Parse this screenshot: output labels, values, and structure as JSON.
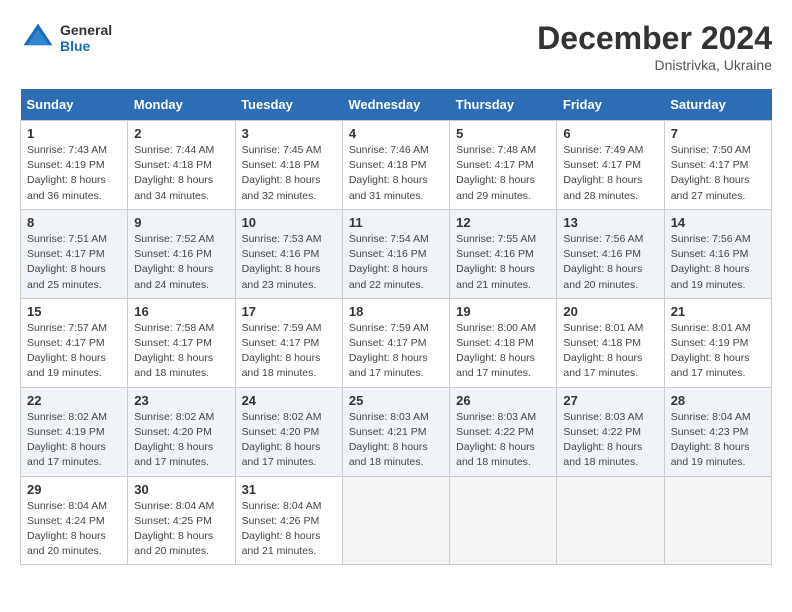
{
  "header": {
    "logo": {
      "general": "General",
      "blue": "Blue"
    },
    "title": "December 2024",
    "subtitle": "Dnistrivka, Ukraine"
  },
  "weekdays": [
    "Sunday",
    "Monday",
    "Tuesday",
    "Wednesday",
    "Thursday",
    "Friday",
    "Saturday"
  ],
  "weeks": [
    [
      {
        "day": "1",
        "sunrise": "7:43 AM",
        "sunset": "4:19 PM",
        "daylight": "8 hours and 36 minutes."
      },
      {
        "day": "2",
        "sunrise": "7:44 AM",
        "sunset": "4:18 PM",
        "daylight": "8 hours and 34 minutes."
      },
      {
        "day": "3",
        "sunrise": "7:45 AM",
        "sunset": "4:18 PM",
        "daylight": "8 hours and 32 minutes."
      },
      {
        "day": "4",
        "sunrise": "7:46 AM",
        "sunset": "4:18 PM",
        "daylight": "8 hours and 31 minutes."
      },
      {
        "day": "5",
        "sunrise": "7:48 AM",
        "sunset": "4:17 PM",
        "daylight": "8 hours and 29 minutes."
      },
      {
        "day": "6",
        "sunrise": "7:49 AM",
        "sunset": "4:17 PM",
        "daylight": "8 hours and 28 minutes."
      },
      {
        "day": "7",
        "sunrise": "7:50 AM",
        "sunset": "4:17 PM",
        "daylight": "8 hours and 27 minutes."
      }
    ],
    [
      {
        "day": "8",
        "sunrise": "7:51 AM",
        "sunset": "4:17 PM",
        "daylight": "8 hours and 25 minutes."
      },
      {
        "day": "9",
        "sunrise": "7:52 AM",
        "sunset": "4:16 PM",
        "daylight": "8 hours and 24 minutes."
      },
      {
        "day": "10",
        "sunrise": "7:53 AM",
        "sunset": "4:16 PM",
        "daylight": "8 hours and 23 minutes."
      },
      {
        "day": "11",
        "sunrise": "7:54 AM",
        "sunset": "4:16 PM",
        "daylight": "8 hours and 22 minutes."
      },
      {
        "day": "12",
        "sunrise": "7:55 AM",
        "sunset": "4:16 PM",
        "daylight": "8 hours and 21 minutes."
      },
      {
        "day": "13",
        "sunrise": "7:56 AM",
        "sunset": "4:16 PM",
        "daylight": "8 hours and 20 minutes."
      },
      {
        "day": "14",
        "sunrise": "7:56 AM",
        "sunset": "4:16 PM",
        "daylight": "8 hours and 19 minutes."
      }
    ],
    [
      {
        "day": "15",
        "sunrise": "7:57 AM",
        "sunset": "4:17 PM",
        "daylight": "8 hours and 19 minutes."
      },
      {
        "day": "16",
        "sunrise": "7:58 AM",
        "sunset": "4:17 PM",
        "daylight": "8 hours and 18 minutes."
      },
      {
        "day": "17",
        "sunrise": "7:59 AM",
        "sunset": "4:17 PM",
        "daylight": "8 hours and 18 minutes."
      },
      {
        "day": "18",
        "sunrise": "7:59 AM",
        "sunset": "4:17 PM",
        "daylight": "8 hours and 17 minutes."
      },
      {
        "day": "19",
        "sunrise": "8:00 AM",
        "sunset": "4:18 PM",
        "daylight": "8 hours and 17 minutes."
      },
      {
        "day": "20",
        "sunrise": "8:01 AM",
        "sunset": "4:18 PM",
        "daylight": "8 hours and 17 minutes."
      },
      {
        "day": "21",
        "sunrise": "8:01 AM",
        "sunset": "4:19 PM",
        "daylight": "8 hours and 17 minutes."
      }
    ],
    [
      {
        "day": "22",
        "sunrise": "8:02 AM",
        "sunset": "4:19 PM",
        "daylight": "8 hours and 17 minutes."
      },
      {
        "day": "23",
        "sunrise": "8:02 AM",
        "sunset": "4:20 PM",
        "daylight": "8 hours and 17 minutes."
      },
      {
        "day": "24",
        "sunrise": "8:02 AM",
        "sunset": "4:20 PM",
        "daylight": "8 hours and 17 minutes."
      },
      {
        "day": "25",
        "sunrise": "8:03 AM",
        "sunset": "4:21 PM",
        "daylight": "8 hours and 18 minutes."
      },
      {
        "day": "26",
        "sunrise": "8:03 AM",
        "sunset": "4:22 PM",
        "daylight": "8 hours and 18 minutes."
      },
      {
        "day": "27",
        "sunrise": "8:03 AM",
        "sunset": "4:22 PM",
        "daylight": "8 hours and 18 minutes."
      },
      {
        "day": "28",
        "sunrise": "8:04 AM",
        "sunset": "4:23 PM",
        "daylight": "8 hours and 19 minutes."
      }
    ],
    [
      {
        "day": "29",
        "sunrise": "8:04 AM",
        "sunset": "4:24 PM",
        "daylight": "8 hours and 20 minutes."
      },
      {
        "day": "30",
        "sunrise": "8:04 AM",
        "sunset": "4:25 PM",
        "daylight": "8 hours and 20 minutes."
      },
      {
        "day": "31",
        "sunrise": "8:04 AM",
        "sunset": "4:26 PM",
        "daylight": "8 hours and 21 minutes."
      },
      null,
      null,
      null,
      null
    ]
  ]
}
